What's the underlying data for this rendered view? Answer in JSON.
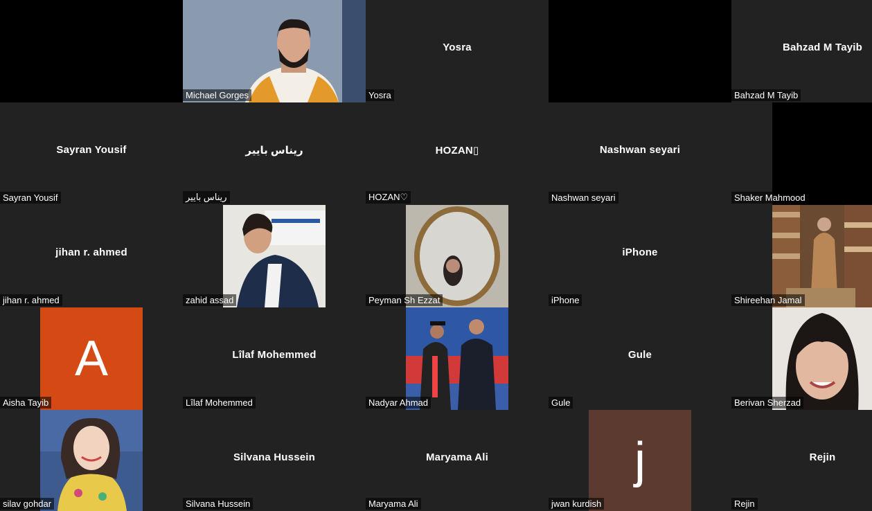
{
  "participants": [
    {
      "name": "",
      "center": ""
    },
    {
      "name": "Michael Gorges"
    },
    {
      "name": "Yosra",
      "center": "Yosra"
    },
    {
      "name": "",
      "center": ""
    },
    {
      "name": "Bahzad M Tayib",
      "center": "Bahzad M Tayib"
    },
    {
      "name": "Sayran Yousif",
      "center": "Sayran Yousif"
    },
    {
      "name": "ريناس بايير",
      "center": "ريناس بايير"
    },
    {
      "name": "HOZAN♡",
      "center": "HOZAN▯"
    },
    {
      "name": "Nashwan seyari",
      "center": "Nashwan seyari"
    },
    {
      "name": "Shaker Mahmood"
    },
    {
      "name": "jihan r. ahmed",
      "center": "jihan r. ahmed"
    },
    {
      "name": "zahid assad"
    },
    {
      "name": "Peyman Sh Ezzat"
    },
    {
      "name": "iPhone",
      "center": "iPhone"
    },
    {
      "name": "Shireehan Jamal"
    },
    {
      "name": "Aisha Tayib",
      "avatar_letter": "A",
      "avatar_color": "#d54a14"
    },
    {
      "name": "Lîlaf Mohemmed",
      "center": "Lîlaf Mohemmed"
    },
    {
      "name": "Nadyar Ahmad"
    },
    {
      "name": "Gule",
      "center": "Gule"
    },
    {
      "name": "Berivan Sherzad"
    },
    {
      "name": "silav gohdar"
    },
    {
      "name": "Silvana Hussein",
      "center": "Silvana Hussein"
    },
    {
      "name": "Maryama Ali",
      "center": "Maryama Ali"
    },
    {
      "name": "jwan kurdish",
      "avatar_letter": "j",
      "avatar_color": "#5c3a2f"
    },
    {
      "name": "Rejin",
      "center": "Rejin"
    }
  ]
}
